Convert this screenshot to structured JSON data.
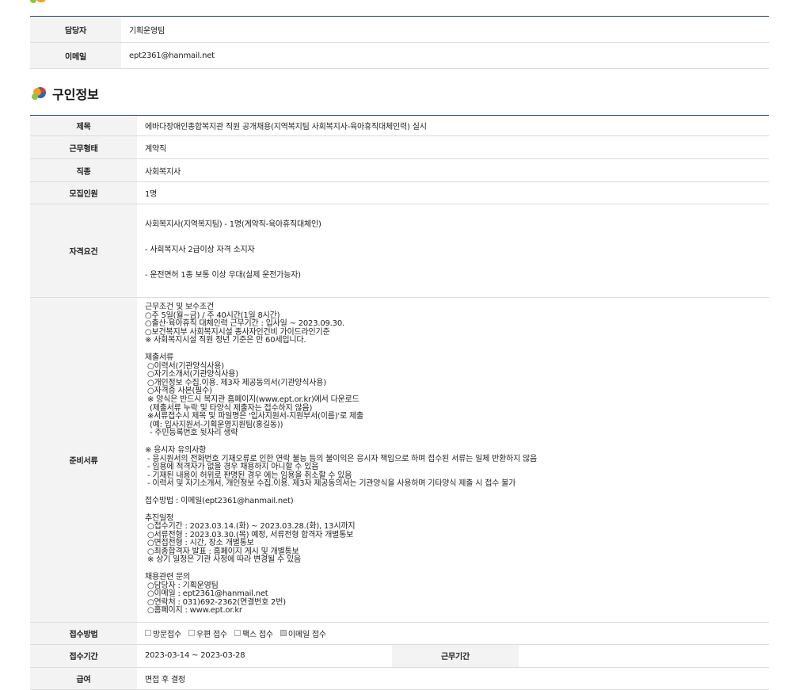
{
  "contact": {
    "rows": [
      {
        "label": "담당자",
        "value": "기획운영팀"
      },
      {
        "label": "이메일",
        "value": "ept2361@hanmail.net"
      }
    ]
  },
  "section": {
    "title": "구인정보"
  },
  "job": {
    "title_label": "제목",
    "title_value": "에바다장애인종합복지관 직원 공개채용(지역복지팀 사회복지사-육아휴직대체인력) 실시",
    "type_label": "근무형태",
    "type_value": "계약직",
    "category_label": "직종",
    "category_value": "사회복지사",
    "count_label": "모집인원",
    "count_value": "1명",
    "qual_label": "자격요건",
    "qual_lines": [
      "사회복지사(지역복지팀) - 1명(계약직-육아휴직대체인)",
      "- 사회복지사 2급이상 자격 소지자",
      "- 운전면허 1종 보통 이상 우대(실제 운전가능자)"
    ],
    "docs_label": "준비서류",
    "docs_blocks": [
      "근무조건 및 보수조건\n○주 5일(월~금) / 주 40시간(1일 8시간)\n○출산·육아휴직 대체인력 근무기간 : 입사일 ~ 2023.09.30.\n○보건복지부 사회복지시설 종사자인건비 가이드라인기준\n※ 사회복지시설 직원 정년 기준은 만 60세입니다.",
      "제출서류\n ○이력서(기관양식사용)\n ○자기소개서(기관양식사용)\n ○개인정보 수집.이용. 제3자 제공동의서(기관양식사용)\n ○자격증 사본(필수)\n ※ 양식은 반드시 복지관 홈페이지(www.ept.or.kr)에서 다운로드\n  (제출서류 누락 및 타양식 제출자는 접수하지 않음)\n ※서류접수시 제목 및 파일명은 '입사지원서-지원부서(이름)'로 제출\n  (예: 입사지원서-기획운영지원팀(홍길동))\n  - 주민등록번호 뒷자리 생략",
      "※ 응시자 유의사항\n - 응시원서의 전화번호 기재오류로 인한 연락 불능 등의 불이익은 응시자 책임으로 하며 접수된 서류는 일체 반환하지 않음\n - 임용에 적격자가 없을 경우 채용하지 아니할 수 있음\n - 기재된 내용이 허위로 판명된 경우 에는 임용을 취소할 수 있음\n - 이력서 및 자기소개서, 개인정보 수집.이용. 제3자 제공동의서는 기관양식을 사용하며 기타양식 제출 시 접수 불가",
      "접수방법 : 이메일(ept2361@hanmail.net)",
      "추진일정\n ○접수기간 : 2023.03.14.(화) ~ 2023.03.28.(화), 13시까지\n ○서류전형 : 2023.03.30.(목) 예정, 서류전형 합격자 개별통보\n ○면접전형 : 시간, 장소 개별통보\n ○최종합격자 발표 : 홈페이지 게시 및 개별통보\n ※ 상기 일정은 기관 사정에 따라 변경될 수 있음",
      "채용관련 문의\n ○담당자 : 기획운영팀\n ○이메일 : ept2361@hanmail.net\n ○연락처 : 031)692-2362(연결번호 2번)\n ○홈페이지 : www.ept.or.kr"
    ],
    "method_label": "접수방법",
    "methods": [
      {
        "label": "방문접수",
        "checked": false
      },
      {
        "label": "우편 접수",
        "checked": false
      },
      {
        "label": "팩스 접수",
        "checked": false
      },
      {
        "label": "이메일 접수",
        "checked": true
      }
    ],
    "period_label": "접수기간",
    "period_value": "2023-03-14 ~ 2023-03-28",
    "work_period_label": "근무기간",
    "work_period_value": "",
    "salary_label": "급여",
    "salary_value": "면접 후 결정"
  }
}
